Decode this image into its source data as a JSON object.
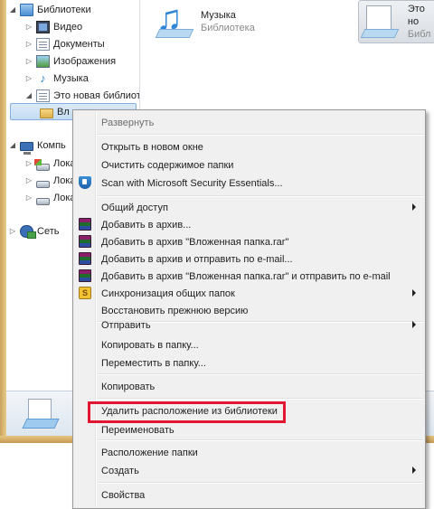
{
  "nav": {
    "items": [
      {
        "label": "Библиотеки"
      },
      {
        "label": "Видео"
      },
      {
        "label": "Документы"
      },
      {
        "label": "Изображения"
      },
      {
        "label": "Музыка"
      },
      {
        "label": "Это новая библиоте"
      },
      {
        "label": "Вл"
      },
      {
        "label": "Компь"
      },
      {
        "label": "Лока"
      },
      {
        "label": "Лока"
      },
      {
        "label": "Лока"
      },
      {
        "label": "Сеть"
      }
    ]
  },
  "content": {
    "tiles": [
      {
        "name": "Музыка",
        "sub": "Библиотека"
      },
      {
        "name": "Это но",
        "sub": "Библ"
      }
    ]
  },
  "menu": {
    "expand": "Развернуть",
    "open_new_window": "Открыть в новом окне",
    "clear_folder": "Очистить содержимое папки",
    "scan_mse": "Scan with Microsoft Security Essentials...",
    "share": "Общий доступ",
    "add_archive": "Добавить в архив...",
    "add_named": "Добавить в архив \"Вложенная папка.rar\"",
    "add_email": "Добавить в архив и отправить по e-mail...",
    "add_named_email": "Добавить в архив \"Вложенная папка.rar\" и отправить по e-mail",
    "sync_shared": "Синхронизация общих папок",
    "restore_prev": "Восстановить прежнюю версию",
    "send_to": "Отправить",
    "copy_to": "Копировать в папку...",
    "move_to": "Переместить в папку...",
    "copy": "Копировать",
    "remove_location": "Удалить расположение из библиотеки",
    "rename": "Переименовать",
    "folder_location": "Расположение папки",
    "create": "Создать",
    "properties": "Свойства"
  },
  "colors": {
    "highlight_border": "#e3162f",
    "menu_bg": "#f0f0f0"
  }
}
